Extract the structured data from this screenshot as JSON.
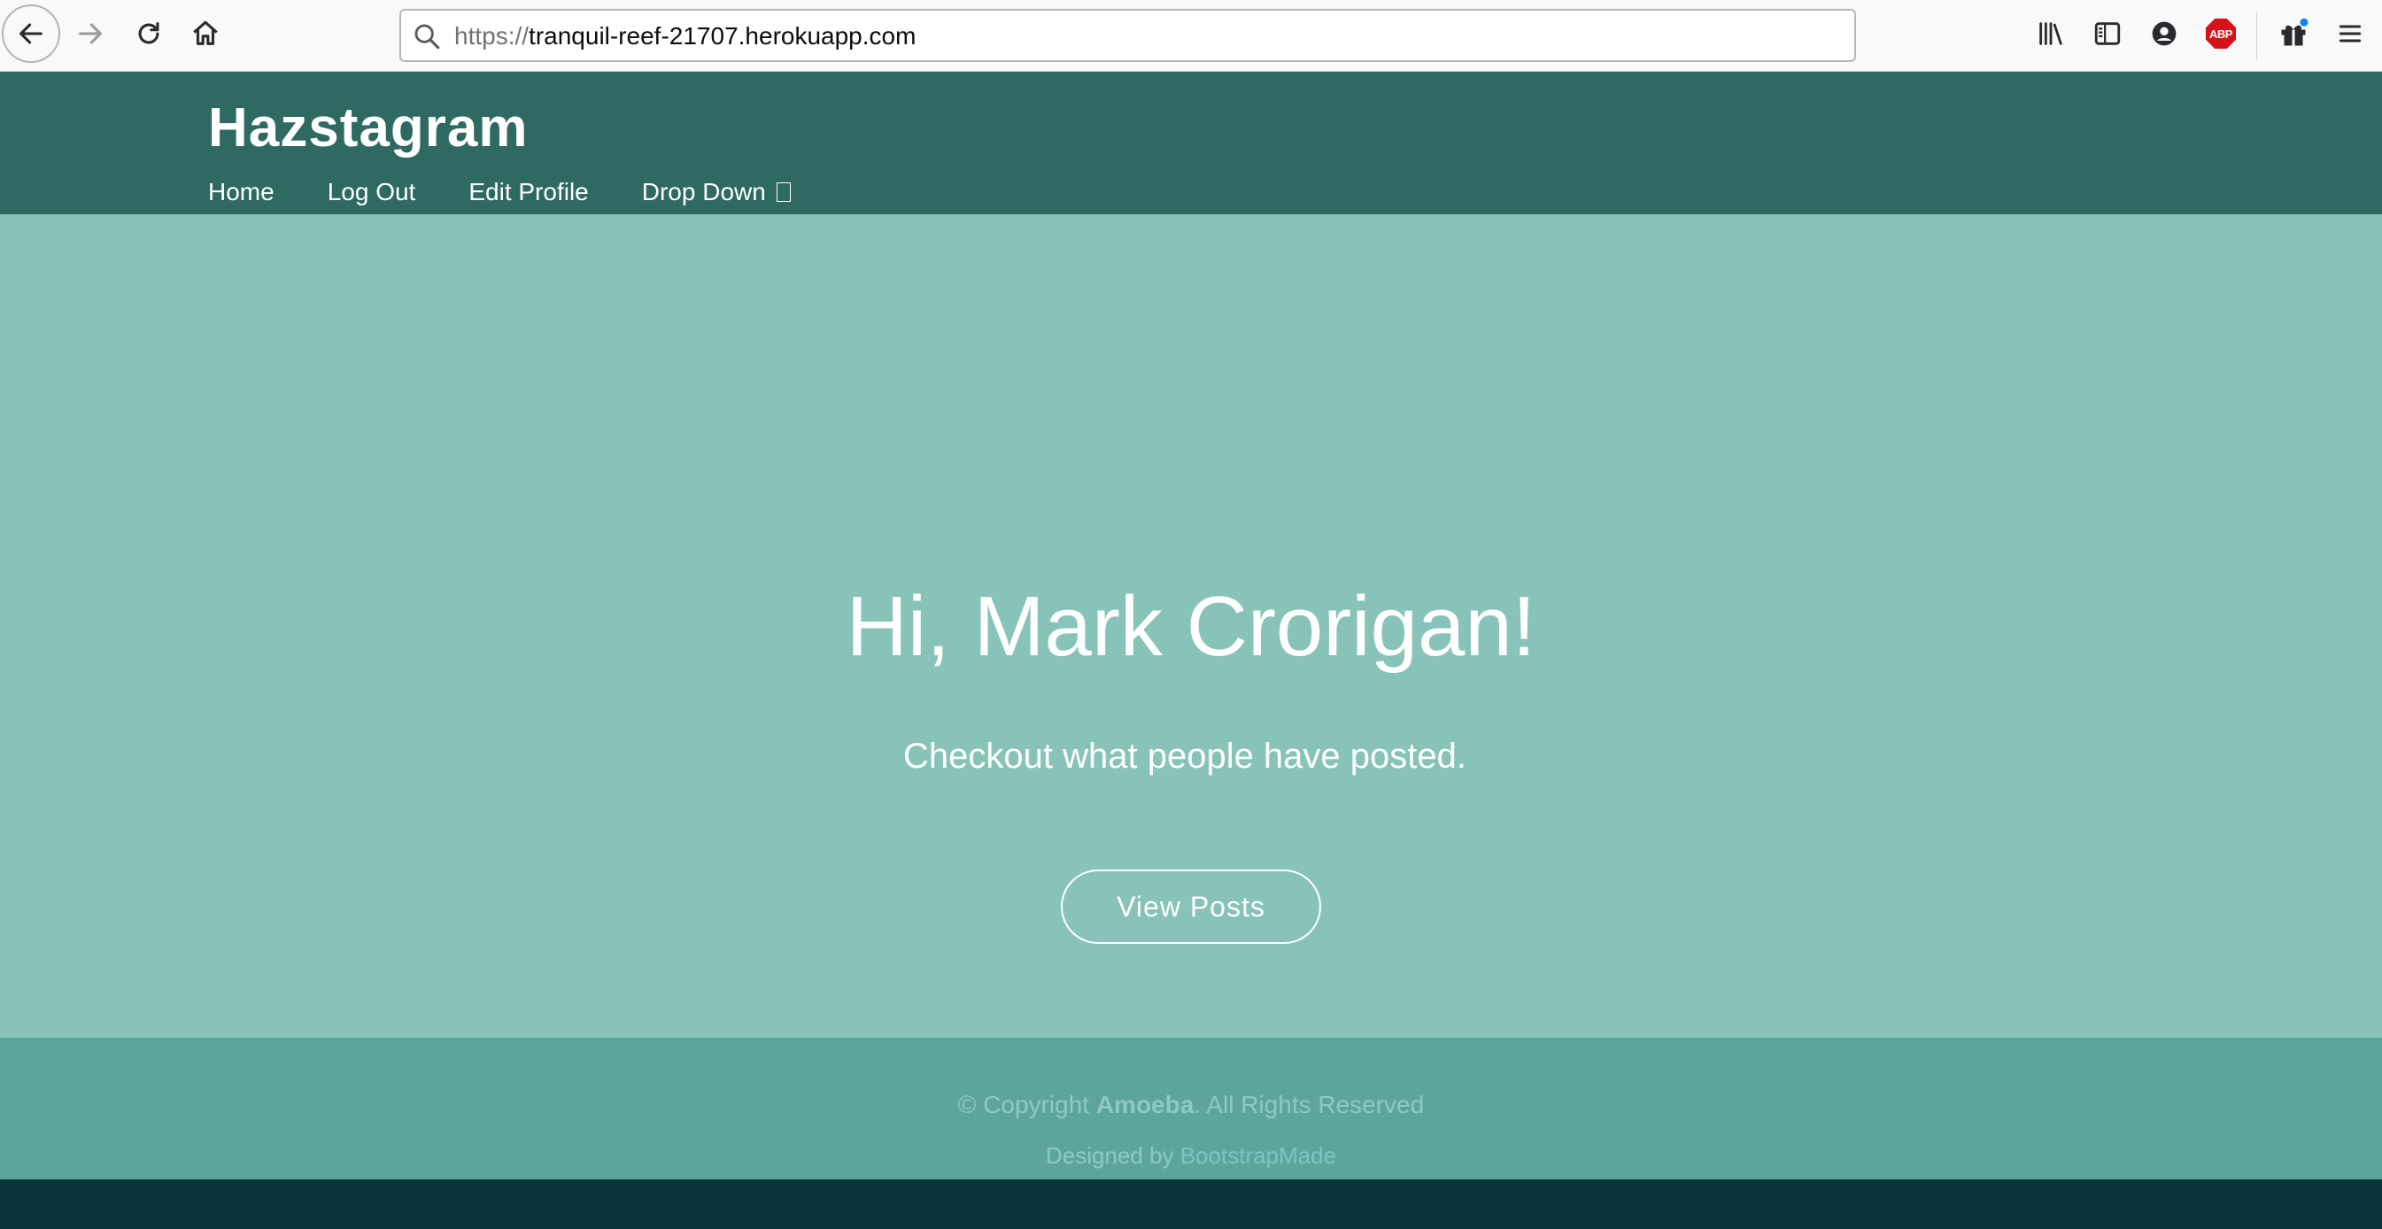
{
  "browser": {
    "url_prefix": "https://",
    "url_host": "tranquil-reef-21707.herokuapp.com",
    "icons": {
      "back": "back-arrow-icon",
      "forward": "forward-arrow-icon",
      "reload": "reload-icon",
      "home": "home-icon",
      "search": "search-icon",
      "library": "library-icon",
      "sidebar": "sidebar-icon",
      "account": "account-icon",
      "adblock": "adblock-icon",
      "gift": "gift-icon",
      "menu": "hamburger-menu-icon"
    },
    "adblock_label": "ABP"
  },
  "site": {
    "brand": "Hazstagram",
    "nav": [
      {
        "label": "Home"
      },
      {
        "label": "Log Out"
      },
      {
        "label": "Edit Profile"
      },
      {
        "label": "Drop Down"
      }
    ]
  },
  "hero": {
    "title": "Hi, Mark Crorigan!",
    "subtitle": "Checkout what people have posted.",
    "button_label": "View Posts"
  },
  "footer": {
    "copyright_prefix": "© Copyright ",
    "company": "Amoeba",
    "copyright_suffix": ". All Rights Reserved",
    "designed_by": "Designed by ",
    "designer": "BootstrapMade"
  },
  "colors": {
    "header": "#2e6962",
    "hero": "#87c3b9",
    "footer": "#5da59b",
    "bottom": "#0a3538"
  }
}
